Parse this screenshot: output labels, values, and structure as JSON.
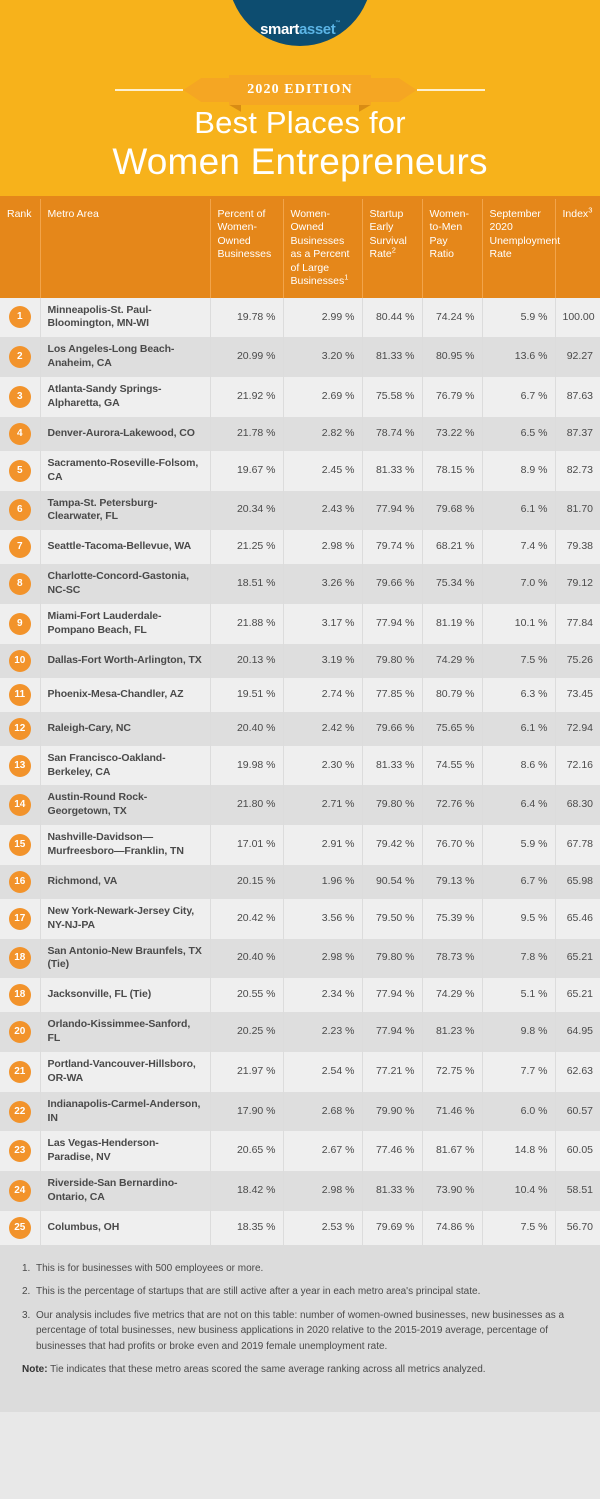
{
  "header": {
    "logo": {
      "part1": "smart",
      "part2": "asset",
      "tm": "™"
    },
    "ribbon_label": "2020 EDITION",
    "title_line1": "Best Places for",
    "title_line2": "Women Entrepreneurs",
    "colors": {
      "background": "#f7b21b",
      "ribbon": "#f5a623",
      "logo_navy": "#0d4d70",
      "logo_blue": "#5bb4e5"
    }
  },
  "table": {
    "columns": [
      {
        "key": "rank",
        "label": "Rank"
      },
      {
        "key": "metro",
        "label": "Metro Area"
      },
      {
        "key": "pct_women_owned",
        "label": "Percent of Women-Owned Businesses"
      },
      {
        "key": "pct_large",
        "label": "Women-Owned Businesses as a Percent of Large Businesses",
        "footnote": "1"
      },
      {
        "key": "startup_survival",
        "label": "Startup Early Survival Rate",
        "footnote": "2"
      },
      {
        "key": "pay_ratio",
        "label": "Women-to-Men Pay Ratio"
      },
      {
        "key": "unemployment",
        "label": "September 2020 Unemployment Rate"
      },
      {
        "key": "index",
        "label": "Index",
        "footnote": "3"
      }
    ],
    "header_colors": {
      "background": "#e5871a",
      "text": "#ffffff"
    },
    "row_colors": {
      "odd": "#efefef",
      "even": "#dedede",
      "badge": "#f2932b"
    },
    "rows": [
      {
        "rank": "1",
        "metro": "Minneapolis-St. Paul-Bloomington, MN-WI",
        "pct_women_owned": "19.78 %",
        "pct_large": "2.99 %",
        "startup_survival": "80.44 %",
        "pay_ratio": "74.24 %",
        "unemployment": "5.9 %",
        "index": "100.00"
      },
      {
        "rank": "2",
        "metro": "Los Angeles-Long Beach-Anaheim, CA",
        "pct_women_owned": "20.99 %",
        "pct_large": "3.20 %",
        "startup_survival": "81.33 %",
        "pay_ratio": "80.95 %",
        "unemployment": "13.6 %",
        "index": "92.27"
      },
      {
        "rank": "3",
        "metro": "Atlanta-Sandy Springs-Alpharetta, GA",
        "pct_women_owned": "21.92 %",
        "pct_large": "2.69 %",
        "startup_survival": "75.58 %",
        "pay_ratio": "76.79 %",
        "unemployment": "6.7 %",
        "index": "87.63"
      },
      {
        "rank": "4",
        "metro": "Denver-Aurora-Lakewood, CO",
        "pct_women_owned": "21.78 %",
        "pct_large": "2.82 %",
        "startup_survival": "78.74 %",
        "pay_ratio": "73.22 %",
        "unemployment": "6.5 %",
        "index": "87.37"
      },
      {
        "rank": "5",
        "metro": "Sacramento-Roseville-Folsom, CA",
        "pct_women_owned": "19.67 %",
        "pct_large": "2.45 %",
        "startup_survival": "81.33 %",
        "pay_ratio": "78.15 %",
        "unemployment": "8.9 %",
        "index": "82.73"
      },
      {
        "rank": "6",
        "metro": "Tampa-St. Petersburg-Clearwater, FL",
        "pct_women_owned": "20.34 %",
        "pct_large": "2.43 %",
        "startup_survival": "77.94 %",
        "pay_ratio": "79.68 %",
        "unemployment": "6.1 %",
        "index": "81.70"
      },
      {
        "rank": "7",
        "metro": "Seattle-Tacoma-Bellevue, WA",
        "pct_women_owned": "21.25 %",
        "pct_large": "2.98 %",
        "startup_survival": "79.74 %",
        "pay_ratio": "68.21 %",
        "unemployment": "7.4 %",
        "index": "79.38"
      },
      {
        "rank": "8",
        "metro": "Charlotte-Concord-Gastonia, NC-SC",
        "pct_women_owned": "18.51 %",
        "pct_large": "3.26 %",
        "startup_survival": "79.66 %",
        "pay_ratio": "75.34 %",
        "unemployment": "7.0 %",
        "index": "79.12"
      },
      {
        "rank": "9",
        "metro": "Miami-Fort Lauderdale-Pompano Beach, FL",
        "pct_women_owned": "21.88 %",
        "pct_large": "3.17 %",
        "startup_survival": "77.94 %",
        "pay_ratio": "81.19 %",
        "unemployment": "10.1 %",
        "index": "77.84"
      },
      {
        "rank": "10",
        "metro": "Dallas-Fort Worth-Arlington, TX",
        "pct_women_owned": "20.13 %",
        "pct_large": "3.19 %",
        "startup_survival": "79.80 %",
        "pay_ratio": "74.29 %",
        "unemployment": "7.5 %",
        "index": "75.26"
      },
      {
        "rank": "11",
        "metro": "Phoenix-Mesa-Chandler, AZ",
        "pct_women_owned": "19.51 %",
        "pct_large": "2.74 %",
        "startup_survival": "77.85 %",
        "pay_ratio": "80.79 %",
        "unemployment": "6.3 %",
        "index": "73.45"
      },
      {
        "rank": "12",
        "metro": "Raleigh-Cary, NC",
        "pct_women_owned": "20.40 %",
        "pct_large": "2.42 %",
        "startup_survival": "79.66 %",
        "pay_ratio": "75.65 %",
        "unemployment": "6.1 %",
        "index": "72.94"
      },
      {
        "rank": "13",
        "metro": "San Francisco-Oakland-Berkeley, CA",
        "pct_women_owned": "19.98 %",
        "pct_large": "2.30 %",
        "startup_survival": "81.33 %",
        "pay_ratio": "74.55 %",
        "unemployment": "8.6 %",
        "index": "72.16"
      },
      {
        "rank": "14",
        "metro": "Austin-Round Rock-Georgetown, TX",
        "pct_women_owned": "21.80 %",
        "pct_large": "2.71 %",
        "startup_survival": "79.80 %",
        "pay_ratio": "72.76 %",
        "unemployment": "6.4 %",
        "index": "68.30"
      },
      {
        "rank": "15",
        "metro": "Nashville-Davidson—Murfreesboro—Franklin, TN",
        "pct_women_owned": "17.01 %",
        "pct_large": "2.91 %",
        "startup_survival": "79.42 %",
        "pay_ratio": "76.70 %",
        "unemployment": "5.9 %",
        "index": "67.78"
      },
      {
        "rank": "16",
        "metro": "Richmond, VA",
        "pct_women_owned": "20.15 %",
        "pct_large": "1.96 %",
        "startup_survival": "90.54 %",
        "pay_ratio": "79.13 %",
        "unemployment": "6.7 %",
        "index": "65.98"
      },
      {
        "rank": "17",
        "metro": "New York-Newark-Jersey City, NY-NJ-PA",
        "pct_women_owned": "20.42 %",
        "pct_large": "3.56 %",
        "startup_survival": "79.50 %",
        "pay_ratio": "75.39 %",
        "unemployment": "9.5 %",
        "index": "65.46"
      },
      {
        "rank": "18",
        "metro": "San Antonio-New Braunfels, TX (Tie)",
        "pct_women_owned": "20.40 %",
        "pct_large": "2.98 %",
        "startup_survival": "79.80 %",
        "pay_ratio": "78.73 %",
        "unemployment": "7.8 %",
        "index": "65.21"
      },
      {
        "rank": "18",
        "metro": "Jacksonville, FL (Tie)",
        "pct_women_owned": "20.55 %",
        "pct_large": "2.34 %",
        "startup_survival": "77.94 %",
        "pay_ratio": "74.29 %",
        "unemployment": "5.1 %",
        "index": "65.21"
      },
      {
        "rank": "20",
        "metro": "Orlando-Kissimmee-Sanford, FL",
        "pct_women_owned": "20.25 %",
        "pct_large": "2.23 %",
        "startup_survival": "77.94 %",
        "pay_ratio": "81.23 %",
        "unemployment": "9.8 %",
        "index": "64.95"
      },
      {
        "rank": "21",
        "metro": "Portland-Vancouver-Hillsboro, OR-WA",
        "pct_women_owned": "21.97 %",
        "pct_large": "2.54 %",
        "startup_survival": "77.21 %",
        "pay_ratio": "72.75 %",
        "unemployment": "7.7 %",
        "index": "62.63"
      },
      {
        "rank": "22",
        "metro": "Indianapolis-Carmel-Anderson, IN",
        "pct_women_owned": "17.90 %",
        "pct_large": "2.68 %",
        "startup_survival": "79.90 %",
        "pay_ratio": "71.46 %",
        "unemployment": "6.0 %",
        "index": "60.57"
      },
      {
        "rank": "23",
        "metro": "Las Vegas-Henderson-Paradise, NV",
        "pct_women_owned": "20.65 %",
        "pct_large": "2.67 %",
        "startup_survival": "77.46 %",
        "pay_ratio": "81.67 %",
        "unemployment": "14.8 %",
        "index": "60.05"
      },
      {
        "rank": "24",
        "metro": "Riverside-San Bernardino-Ontario, CA",
        "pct_women_owned": "18.42 %",
        "pct_large": "2.98 %",
        "startup_survival": "81.33 %",
        "pay_ratio": "73.90 %",
        "unemployment": "10.4 %",
        "index": "58.51"
      },
      {
        "rank": "25",
        "metro": "Columbus, OH",
        "pct_women_owned": "18.35 %",
        "pct_large": "2.53 %",
        "startup_survival": "79.69 %",
        "pay_ratio": "74.86 %",
        "unemployment": "7.5 %",
        "index": "56.70"
      }
    ]
  },
  "footnotes": {
    "items": [
      {
        "num": "1.",
        "text": "This is for businesses with 500 employees or more."
      },
      {
        "num": "2.",
        "text": "This is the percentage of startups that are still active after a year in each metro area's principal state."
      },
      {
        "num": "3.",
        "text": "Our analysis includes five metrics that are not on this table: number of women-owned businesses, new businesses as a percentage of total businesses, new business applications in 2020 relative to the 2015-2019 average, percentage of businesses that had profits or broke even and 2019 female unemployment rate."
      }
    ],
    "note_label": "Note:",
    "note_text": "Tie indicates that these metro areas scored the same average ranking across all metrics analyzed."
  }
}
